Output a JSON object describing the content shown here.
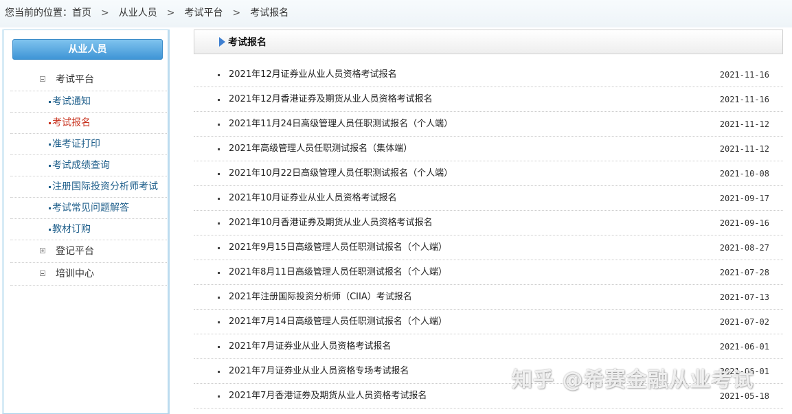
{
  "breadcrumb": {
    "prefix": "您当前的位置：",
    "items": [
      "首页",
      "从业人员",
      "考试平台",
      "考试报名"
    ],
    "separator": ">"
  },
  "sidebar": {
    "header": "从业人员",
    "groups": [
      {
        "label": "考试平台",
        "expanded": true,
        "items": [
          {
            "label": "考试通知",
            "active": false
          },
          {
            "label": "考试报名",
            "active": true
          },
          {
            "label": "准考证打印",
            "active": false
          },
          {
            "label": "考试成绩查询",
            "active": false
          },
          {
            "label": "注册国际投资分析师考试",
            "active": false
          },
          {
            "label": "考试常见问题解答",
            "active": false
          },
          {
            "label": "教材订购",
            "active": false
          }
        ]
      },
      {
        "label": "登记平台",
        "expanded": false,
        "items": []
      },
      {
        "label": "培训中心",
        "expanded": true,
        "items": []
      }
    ]
  },
  "main": {
    "title": "考试报名",
    "rows": [
      {
        "title": "2021年12月证券业从业人员资格考试报名",
        "date": "2021-11-16"
      },
      {
        "title": "2021年12月香港证券及期货从业人员资格考试报名",
        "date": "2021-11-16"
      },
      {
        "title": "2021年11月24日高级管理人员任职测试报名（个人端）",
        "date": "2021-11-12"
      },
      {
        "title": "2021年高级管理人员任职测试报名（集体端）",
        "date": "2021-11-12"
      },
      {
        "title": "2021年10月22日高级管理人员任职测试报名（个人端）",
        "date": "2021-10-08"
      },
      {
        "title": "2021年10月证券业从业人员资格考试报名",
        "date": "2021-09-17"
      },
      {
        "title": "2021年10月香港证券及期货从业人员资格考试报名",
        "date": "2021-09-16"
      },
      {
        "title": "2021年9月15日高级管理人员任职测试报名（个人端）",
        "date": "2021-08-27"
      },
      {
        "title": "2021年8月11日高级管理人员任职测试报名（个人端）",
        "date": "2021-07-28"
      },
      {
        "title": "2021年注册国际投资分析师（CIIA）考试报名",
        "date": "2021-07-13"
      },
      {
        "title": "2021年7月14日高级管理人员任职测试报名（个人端）",
        "date": "2021-07-02"
      },
      {
        "title": "2021年7月证券业从业人员资格考试报名",
        "date": "2021-06-01"
      },
      {
        "title": "2021年7月证券业从业人员资格专场考试报名",
        "date": "2021-06-01"
      },
      {
        "title": "2021年7月香港证券及期货从业人员资格考试报名",
        "date": "2021-05-18"
      }
    ]
  },
  "watermark": "知乎 @希赛金融从业考试",
  "colors": {
    "accent": "#3f95d6",
    "active": "#c8321e",
    "link": "#1f5f8b"
  }
}
